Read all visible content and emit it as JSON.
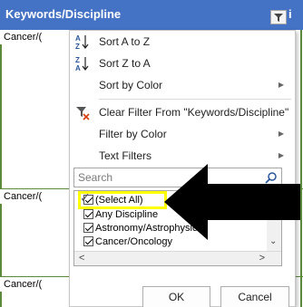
{
  "sheet": {
    "header_label": "Keywords/Discipline",
    "header_edge": "i",
    "cells": [
      "Cancer/(",
      "Cancer/(",
      "Cancer/("
    ]
  },
  "menu": {
    "items": [
      {
        "label": "Sort A to Z",
        "icon": "sort-a-z-icon"
      },
      {
        "label": "Sort Z to A",
        "icon": "sort-z-a-icon"
      },
      {
        "label": "Sort by Color",
        "submenu": true
      },
      {
        "label": "Clear Filter From \"Keywords/Discipline\"",
        "icon": "clear-filter-icon"
      },
      {
        "label": "Filter by Color",
        "submenu": true
      },
      {
        "label": "Text Filters",
        "submenu": true
      }
    ],
    "search_placeholder": "Search",
    "list": [
      "(Select All)",
      "Any Discipline",
      "Astronomy/Astrophysics",
      "Cancer/Oncology"
    ],
    "ok_label": "OK",
    "cancel_label": "Cancel"
  },
  "colors": {
    "header_bg": "#4472c4",
    "highlight": "#ffff00",
    "arrow": "#000000",
    "grid_line": "#5a8a3a"
  }
}
